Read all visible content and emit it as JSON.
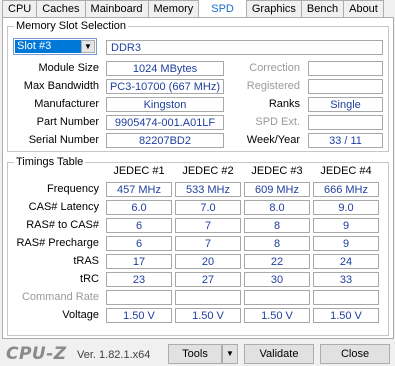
{
  "tabs": [
    "CPU",
    "Caches",
    "Mainboard",
    "Memory",
    "SPD",
    "Graphics",
    "Bench",
    "About"
  ],
  "memory_slot": {
    "legend": "Memory Slot Selection",
    "slot": "Slot #3",
    "type": "DDR3",
    "module_size_label": "Module Size",
    "module_size": "1024 MBytes",
    "max_bandwidth_label": "Max Bandwidth",
    "max_bandwidth": "PC3-10700 (667 MHz)",
    "manufacturer_label": "Manufacturer",
    "manufacturer": "Kingston",
    "part_number_label": "Part Number",
    "part_number": "9905474-001.A01LF",
    "serial_number_label": "Serial Number",
    "serial_number": "82207BD2",
    "correction_label": "Correction",
    "correction": "",
    "registered_label": "Registered",
    "registered": "",
    "ranks_label": "Ranks",
    "ranks": "Single",
    "spd_ext_label": "SPD Ext.",
    "spd_ext": "",
    "week_year_label": "Week/Year",
    "week_year": "33 / 11"
  },
  "timings": {
    "legend": "Timings Table",
    "headers": [
      "JEDEC #1",
      "JEDEC #2",
      "JEDEC #3",
      "JEDEC #4"
    ],
    "rows": [
      {
        "label": "Frequency",
        "values": [
          "457 MHz",
          "533 MHz",
          "609 MHz",
          "666 MHz"
        ]
      },
      {
        "label": "CAS# Latency",
        "values": [
          "6.0",
          "7.0",
          "8.0",
          "9.0"
        ]
      },
      {
        "label": "RAS# to CAS#",
        "values": [
          "6",
          "7",
          "8",
          "9"
        ]
      },
      {
        "label": "RAS# Precharge",
        "values": [
          "6",
          "7",
          "8",
          "9"
        ]
      },
      {
        "label": "tRAS",
        "values": [
          "17",
          "20",
          "22",
          "24"
        ]
      },
      {
        "label": "tRC",
        "values": [
          "23",
          "27",
          "30",
          "33"
        ]
      },
      {
        "label": "Command Rate",
        "values": [
          "",
          "",
          "",
          ""
        ]
      },
      {
        "label": "Voltage",
        "values": [
          "1.50 V",
          "1.50 V",
          "1.50 V",
          "1.50 V"
        ]
      }
    ]
  },
  "footer": {
    "logo": "CPU-Z",
    "version": "Ver. 1.82.1.x64",
    "tools": "Tools",
    "validate": "Validate",
    "close": "Close"
  },
  "colors": {
    "value_text": "#1f3fa0",
    "active_tab": "#1a6dcc"
  }
}
